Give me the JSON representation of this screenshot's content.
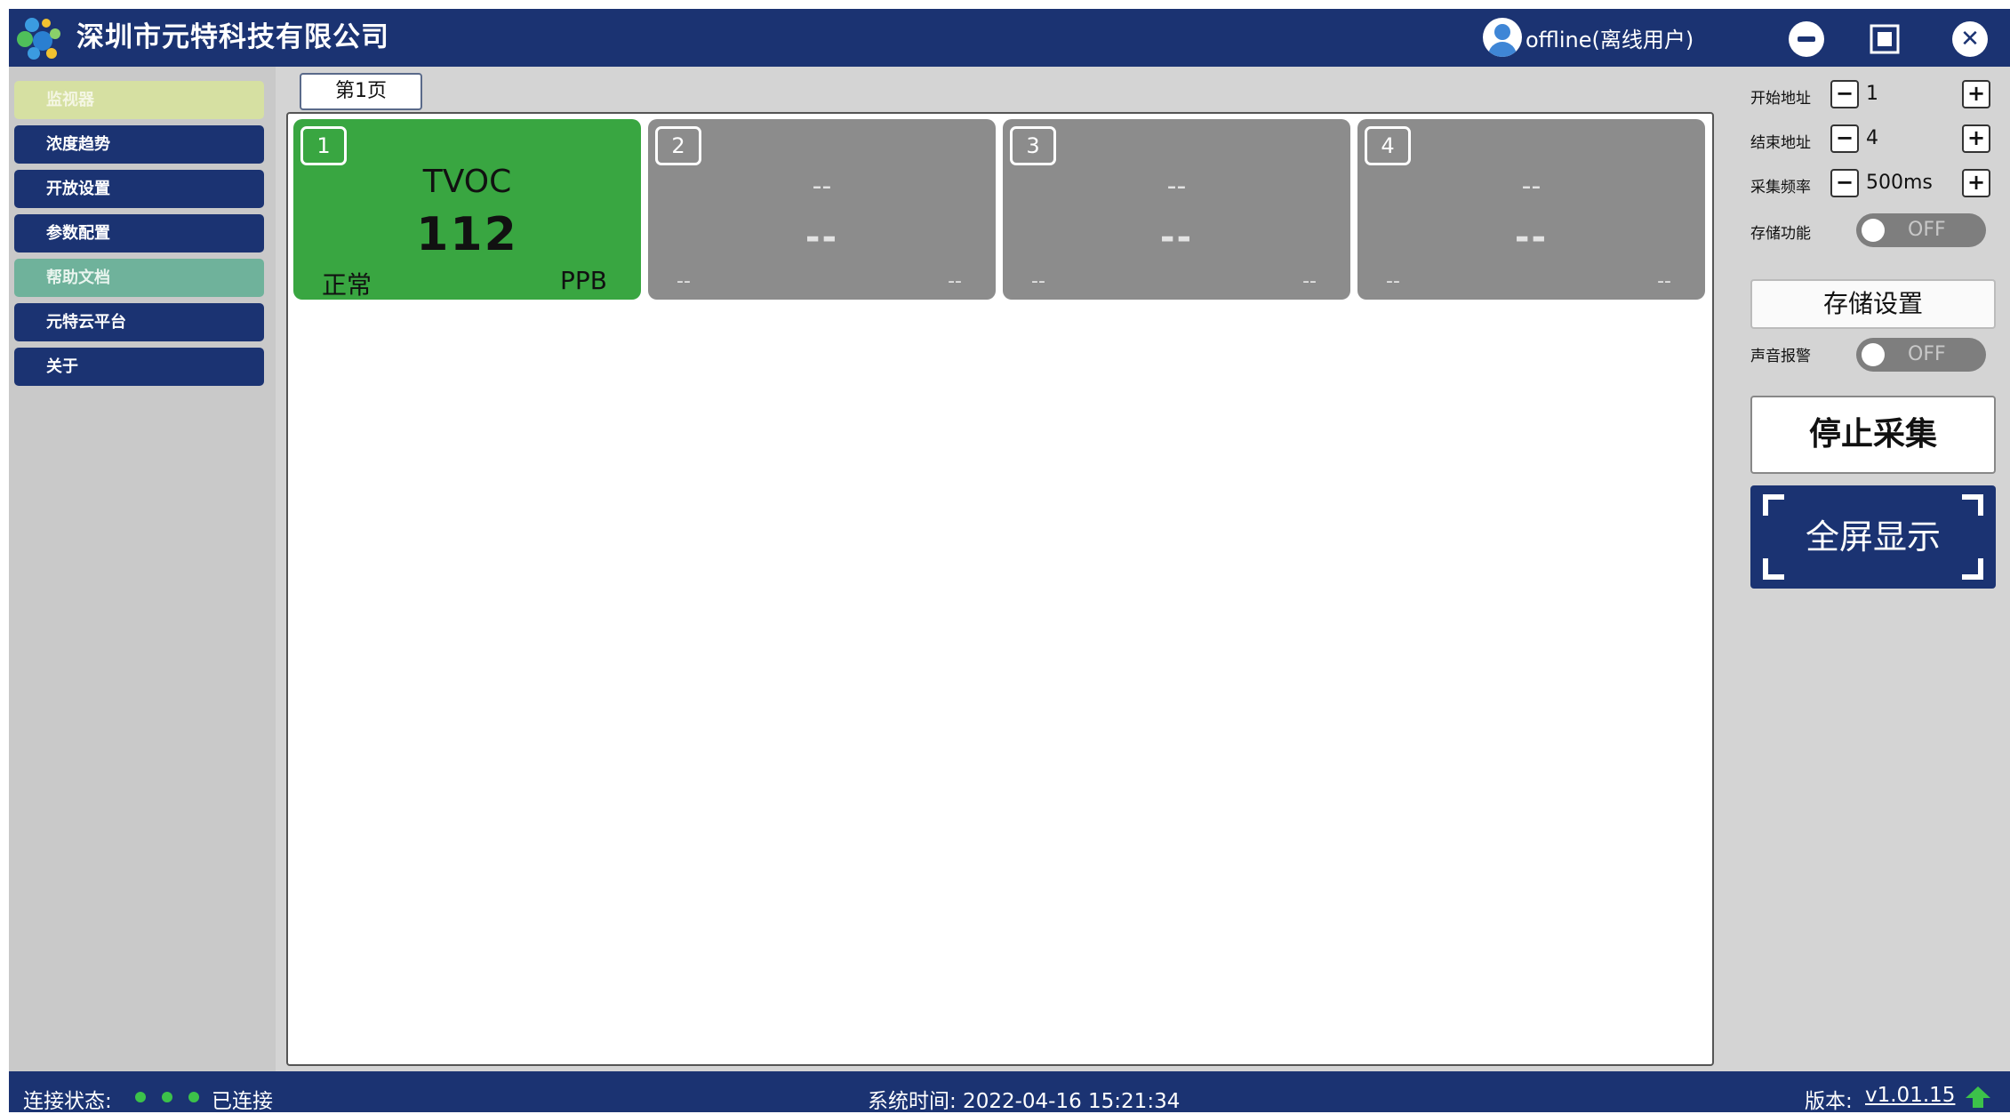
{
  "app": {
    "title": "深圳市元特科技有限公司",
    "user": "offline(离线用户)"
  },
  "sidebar": {
    "items": [
      {
        "label": "监视器"
      },
      {
        "label": "浓度趋势"
      },
      {
        "label": "开放设置"
      },
      {
        "label": "参数配置"
      },
      {
        "label": "帮助文档"
      },
      {
        "label": "元特云平台"
      },
      {
        "label": "关于"
      }
    ]
  },
  "tabs": [
    {
      "label": "第1页"
    }
  ],
  "cards": [
    {
      "num": "1",
      "name": "TVOC",
      "value": "112",
      "status": "正常",
      "unit": "PPB"
    },
    {
      "num": "2",
      "name": "--",
      "value": "--",
      "status": "--",
      "unit": "--"
    },
    {
      "num": "3",
      "name": "--",
      "value": "--",
      "status": "--",
      "unit": "--"
    },
    {
      "num": "4",
      "name": "--",
      "value": "--",
      "status": "--",
      "unit": "--"
    }
  ],
  "controls": {
    "start_addr_label": "开始地址",
    "start_addr_value": "1",
    "end_addr_label": "结束地址",
    "end_addr_value": "4",
    "freq_label": "采集频率",
    "freq_value": "500ms",
    "storage_label": "存储功能",
    "storage_toggle": "OFF",
    "storage_settings": "存储设置",
    "alarm_label": "声音报警",
    "alarm_toggle": "OFF",
    "stop_button": "停止采集",
    "fullscreen_button": "全屏显示",
    "minus": "−",
    "plus": "+"
  },
  "status_bar": {
    "connection_label": "连接状态:",
    "connection_text": "已连接",
    "system_time": "系统时间: 2022-04-16 15:21:34",
    "version_label": "版本:",
    "version": "v1.01.15"
  },
  "colors": {
    "primary": "#1b3372",
    "card_active": "#39a641",
    "card_inactive": "#8c8c8c",
    "status_dot": "#3cc24a"
  }
}
